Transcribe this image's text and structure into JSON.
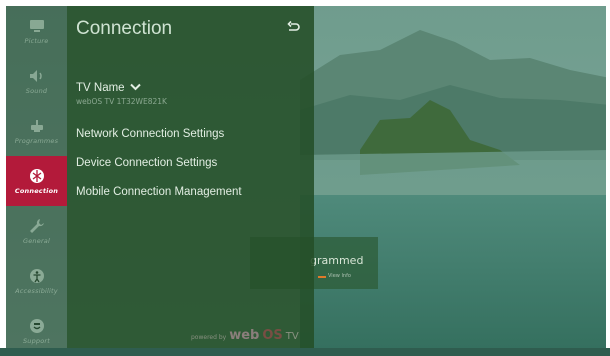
{
  "sidebar": {
    "items": [
      {
        "label": "Picture",
        "icon": "picture-icon",
        "active": false
      },
      {
        "label": "Sound",
        "icon": "speaker-icon",
        "active": false
      },
      {
        "label": "Programmes",
        "icon": "antenna-icon",
        "active": false
      },
      {
        "label": "Connection",
        "icon": "globe-icon",
        "active": true
      },
      {
        "label": "General",
        "icon": "wrench-icon",
        "active": false
      },
      {
        "label": "Accessibility",
        "icon": "accessibility-icon",
        "active": false
      },
      {
        "label": "Support",
        "icon": "support-icon",
        "active": false
      }
    ]
  },
  "panel": {
    "title": "Connection",
    "back_icon": "back-arrow-icon",
    "tv_name_label": "TV Name",
    "tv_name_value": "webOS TV 1T32WE821K",
    "items": [
      "Network Connection Settings",
      "Device Connection Settings",
      "Mobile Connection Management"
    ],
    "powered_by": "powered by",
    "brand_web": "web",
    "brand_os": "OS",
    "brand_tv": "TV"
  },
  "notice": {
    "text": "grammed",
    "view_label": "View Info"
  },
  "colors": {
    "active_category": "#b31a3a",
    "panel_bg": "#244e28",
    "accent_orange": "#e07a2a"
  }
}
